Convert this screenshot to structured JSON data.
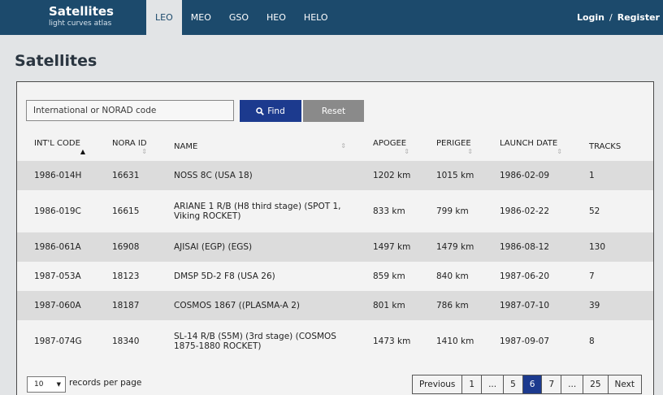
{
  "brand": {
    "title": "Satellites",
    "subtitle": "light curves atlas"
  },
  "nav": {
    "tabs": [
      "LEO",
      "MEO",
      "GSO",
      "HEO",
      "HELO"
    ],
    "active_index": 0
  },
  "auth": {
    "login": "Login",
    "separator": "/",
    "register": "Register"
  },
  "page_title": "Satellites",
  "search": {
    "placeholder": "International or NORAD code",
    "find_label": "Find",
    "reset_label": "Reset"
  },
  "table": {
    "columns": [
      "INT'L CODE",
      "NORA ID",
      "NAME",
      "APOGEE",
      "PERIGEE",
      "LAUNCH DATE",
      "TRACKS"
    ],
    "sorted_column": 0,
    "rows": [
      [
        "1986-014H",
        "16631",
        "NOSS 8C (USA 18)",
        "1202 km",
        "1015 km",
        "1986-02-09",
        "1"
      ],
      [
        "1986-019C",
        "16615",
        "ARIANE 1 R/B (H8 third stage) (SPOT 1, Viking ROCKET)",
        "833 km",
        "799 km",
        "1986-02-22",
        "52"
      ],
      [
        "1986-061A",
        "16908",
        "AJISAI (EGP) (EGS)",
        "1497 km",
        "1479 km",
        "1986-08-12",
        "130"
      ],
      [
        "1987-053A",
        "18123",
        "DMSP 5D-2 F8 (USA 26)",
        "859 km",
        "840 km",
        "1987-06-20",
        "7"
      ],
      [
        "1987-060A",
        "18187",
        "COSMOS 1867 ((PLASMA-A 2)",
        "801 km",
        "786 km",
        "1987-07-10",
        "39"
      ],
      [
        "1987-074G",
        "18340",
        "SL-14 R/B (S5M) (3rd stage) (COSMOS 1875-1880 ROCKET)",
        "1473 km",
        "1410 km",
        "1987-09-07",
        "8"
      ]
    ]
  },
  "footer": {
    "page_size": "10",
    "page_size_label": "records per page",
    "pagination": [
      "Previous",
      "1",
      "...",
      "5",
      "6",
      "7",
      "...",
      "25",
      "Next"
    ],
    "current_page": "6"
  },
  "colors": {
    "navbar": "#1c4a6c",
    "primary": "#1c3a8e",
    "reset": "#8a8a8a"
  }
}
